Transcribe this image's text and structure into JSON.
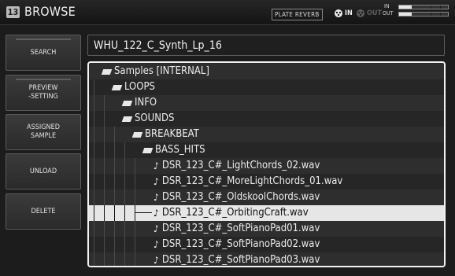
{
  "header": {
    "badge": "13",
    "title": "BROWSE",
    "effect_label": "PLATE REVERB",
    "io_in_label": "IN",
    "io_out_label": "OUT",
    "meter_in_label": "IN",
    "meter_out_label": "OUT",
    "meter_in_level": 0.25,
    "meter_out_level": 0.25
  },
  "sidebar": {
    "buttons": [
      {
        "lines": [
          "SEARCH"
        ]
      },
      {
        "lines": [
          "PREVIEW",
          "-SETTING"
        ]
      },
      {
        "lines": [
          "ASSIGNED",
          "SAMPLE"
        ]
      },
      {
        "lines": [
          "UNLOAD"
        ]
      },
      {
        "lines": [
          "DELETE"
        ]
      }
    ]
  },
  "path": "WHU_122_C_Synth_Lp_16",
  "tree": {
    "rows": [
      {
        "label": "Samples [INTERNAL]",
        "icon": "folder-icon",
        "depth": 0
      },
      {
        "label": "LOOPS",
        "icon": "folder-icon",
        "depth": 1
      },
      {
        "label": "INFO",
        "icon": "folder-icon",
        "depth": 2
      },
      {
        "label": "SOUNDS",
        "icon": "folder-icon",
        "depth": 2
      },
      {
        "label": "BREAKBEAT",
        "icon": "folder-icon",
        "depth": 3
      },
      {
        "label": "BASS_HITS",
        "icon": "folder-icon",
        "depth": 4
      },
      {
        "label": "DSR_123_C#_LightChords_02.wav",
        "icon": "note-icon",
        "depth": 5
      },
      {
        "label": "DSR_123_C#_MoreLightChords_01.wav",
        "icon": "note-icon",
        "depth": 5
      },
      {
        "label": "DSR_123_C#_OldskoolChords.wav",
        "icon": "note-icon",
        "depth": 5
      },
      {
        "label": "DSR_123_C#_OrbitingCraft.wav",
        "icon": "note-icon",
        "depth": 5,
        "selected": true
      },
      {
        "label": "DSR_123_C#_SoftPianoPad01.wav",
        "icon": "note-icon",
        "depth": 5
      },
      {
        "label": "DSR_123_C#_SoftPianoPad02.wav",
        "icon": "note-icon",
        "depth": 5
      },
      {
        "label": "DSR_123_C#_SoftPianoPad03.wav",
        "icon": "note-icon",
        "depth": 5
      }
    ]
  },
  "colors": {
    "background": "#1c1c1c",
    "selected_row": "#e6e6e6",
    "frame_border": "#f2f2f2"
  }
}
